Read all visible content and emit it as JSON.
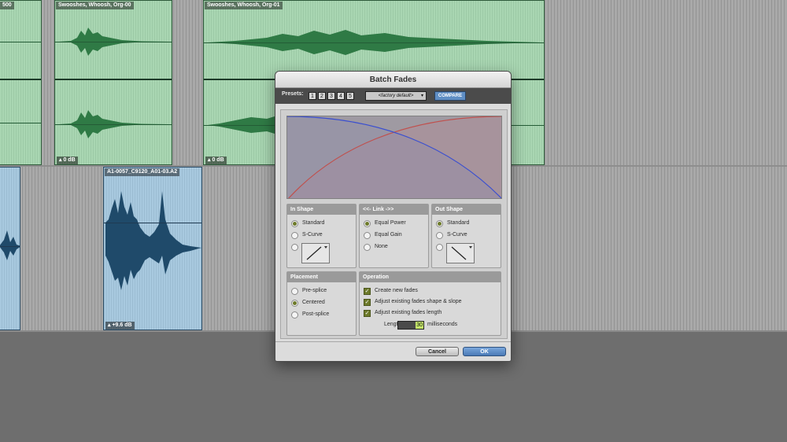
{
  "timeline": {
    "clips": [
      {
        "id": "clip-top-left",
        "name": "500",
        "gain": ""
      },
      {
        "id": "clip-swoosh-00",
        "name": "Swooshes, Whoosh, Org-00",
        "gain": "0 dB"
      },
      {
        "id": "clip-swoosh-01",
        "name": "Swooshes, Whoosh, Org-01",
        "gain": "0 dB"
      },
      {
        "id": "clip-bottom-left",
        "name": "",
        "gain": ""
      },
      {
        "id": "clip-a1",
        "name": "A1-0057_C9120_A01-03.A2",
        "gain": "+9.6 dB"
      }
    ]
  },
  "dialog": {
    "title": "Batch Fades",
    "presets": {
      "label": "Presets:",
      "slots": [
        "1",
        "2",
        "3",
        "4",
        "5"
      ],
      "selected": "<factory default>",
      "compare_label": "COMPARE"
    },
    "in_shape": {
      "title": "In Shape",
      "options": [
        {
          "label": "Standard",
          "selected": true
        },
        {
          "label": "S-Curve",
          "selected": false
        }
      ]
    },
    "link": {
      "title": "<<- Link ->>",
      "options": [
        {
          "label": "Equal Power",
          "selected": true
        },
        {
          "label": "Equal Gain",
          "selected": false
        },
        {
          "label": "None",
          "selected": false
        }
      ]
    },
    "out_shape": {
      "title": "Out Shape",
      "options": [
        {
          "label": "Standard",
          "selected": true
        },
        {
          "label": "S-Curve",
          "selected": false
        }
      ]
    },
    "placement": {
      "title": "Placement",
      "options": [
        {
          "label": "Pre-splice",
          "selected": false
        },
        {
          "label": "Centered",
          "selected": true
        },
        {
          "label": "Post-splice",
          "selected": false
        }
      ]
    },
    "operation": {
      "title": "Operation",
      "checks": [
        {
          "label": "Create new fades",
          "checked": true
        },
        {
          "label": "Adjust existing fades shape & slope",
          "checked": true
        },
        {
          "label": "Adjust existing fades length",
          "checked": true
        }
      ],
      "length_label": "Length:",
      "length_value": "30",
      "length_unit": "milliseconds"
    },
    "cancel_label": "Cancel",
    "ok_label": "OK"
  },
  "colors": {
    "fade_in_curve": "#c0504d",
    "fade_out_curve": "#3a4fd0",
    "radio_on": "#6d7a2a",
    "length_highlight": "#c6e86a"
  }
}
